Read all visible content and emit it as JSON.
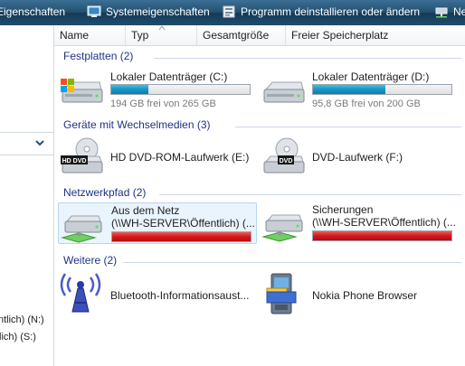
{
  "toolbar": {
    "items": [
      {
        "label": "Eigenschaften",
        "icon": "properties-icon"
      },
      {
        "label": "Systemeigenschaften",
        "icon": "system-properties-icon"
      },
      {
        "label": "Programm deinstallieren oder ändern",
        "icon": "uninstall-icon"
      },
      {
        "label": "Ne",
        "icon": "network-drive-icon"
      }
    ]
  },
  "nav": {
    "items": [
      {
        "label": "ntlich) (N:)"
      },
      {
        "label": "lich) (S:)"
      }
    ]
  },
  "columns": [
    "Name",
    "Typ",
    "Gesamtgröße",
    "Freier Speicherplatz"
  ],
  "groups": [
    {
      "title": "Festplatten (2)",
      "items": [
        {
          "name": "Lokaler Datenträger (C:)",
          "free_text": "194 GB frei von 265 GB",
          "used_fraction": 0.27,
          "icon": "windows-hard-drive-icon"
        },
        {
          "name": "Lokaler Datenträger (D:)",
          "free_text": "95,8 GB frei von 200 GB",
          "used_fraction": 0.52,
          "icon": "hard-drive-icon"
        }
      ]
    },
    {
      "title": "Geräte mit Wechselmedien (3)",
      "items": [
        {
          "name": "HD DVD-ROM-Laufwerk (E:)",
          "badge": "HD DVD",
          "icon": "hd-dvd-drive-icon"
        },
        {
          "name": "DVD-Laufwerk (F:)",
          "badge": "DVD",
          "icon": "dvd-drive-icon"
        }
      ]
    },
    {
      "title": "Netzwerkpfad (2)",
      "items": [
        {
          "name": "Aus dem Netz",
          "sub": "(\\\\WH-SERVER\\Öffentlich) (...",
          "used_fraction": 1.0,
          "selected": true,
          "icon": "network-drive-icon"
        },
        {
          "name": "Sicherungen",
          "sub": "(\\\\WH-SERVER\\Öffentlich) (...",
          "used_fraction": 1.0,
          "icon": "network-drive-icon"
        }
      ]
    },
    {
      "title": "Weitere (2)",
      "items": [
        {
          "name": "Bluetooth-Informationsaust...",
          "icon": "bluetooth-antenna-icon"
        },
        {
          "name": "Nokia Phone Browser",
          "icon": "nokia-phone-browser-icon"
        }
      ]
    }
  ],
  "colors": {
    "toolbar": "#23506f",
    "group_title": "#1e3287",
    "capacity_bar": "#1996c4",
    "capacity_bar_full": "#d4161b",
    "selection": "#e9f4fd"
  }
}
